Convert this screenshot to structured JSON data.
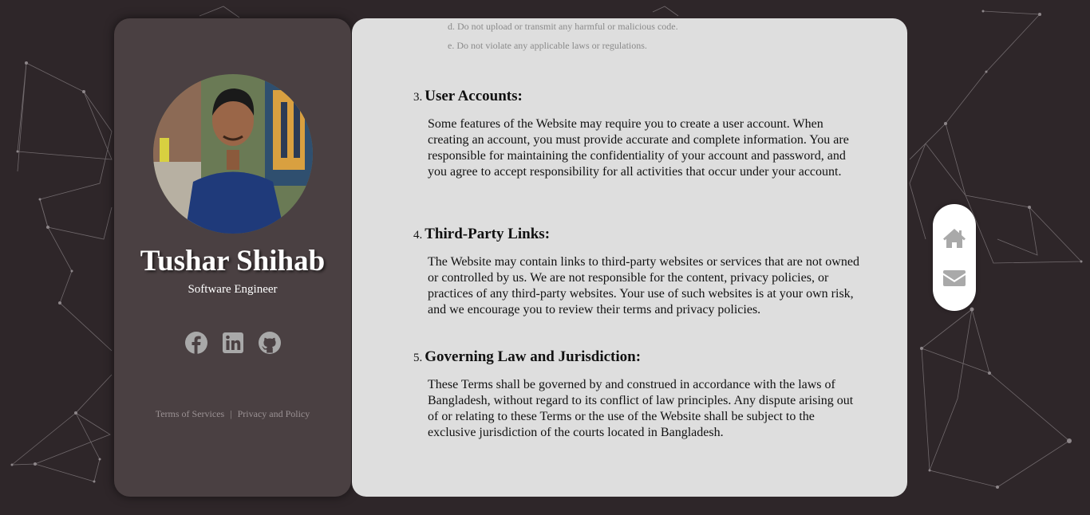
{
  "profile": {
    "name": "Tushar Shihab",
    "role": "Software Engineer",
    "social_icons": [
      "facebook-icon",
      "linkedin-icon",
      "github-icon"
    ],
    "footer": {
      "terms_label": "Terms of Services",
      "separator": "|",
      "privacy_label": "Privacy and Policy"
    }
  },
  "terms": {
    "items": [
      "d. Do not upload or transmit any harmful or malicious code.",
      "e. Do not violate any applicable laws or regulations."
    ],
    "sections": [
      {
        "number": "3.",
        "title": "User Accounts:",
        "body": "Some features of the Website may require you to create a user account. When creating an account, you must provide accurate and complete information. You are responsible for maintaining the confidentiality of your account and password, and you agree to accept responsibility for all activities that occur under your account."
      },
      {
        "number": "4.",
        "title": "Third-Party Links:",
        "body": "The Website may contain links to third-party websites or services that are not owned or controlled by us. We are not responsible for the content, privacy policies, or practices of any third-party websites. Your use of such websites is at your own risk, and we encourage you to review their terms and privacy policies."
      },
      {
        "number": "5.",
        "title": "Governing Law and Jurisdiction:",
        "body": "These Terms shall be governed by and construed in accordance with the laws of Bangladesh, without regard to its conflict of law principles. Any dispute arising out of or relating to these Terms or the use of the Website shall be subject to the exclusive jurisdiction of the courts located in Bangladesh."
      }
    ]
  },
  "nav": {
    "icons": [
      "home-icon",
      "envelope-icon"
    ]
  },
  "colors": {
    "background": "#2e2629",
    "card": "#4a4042",
    "content": "#dedede",
    "icon_gray": "#a9a9a9"
  }
}
